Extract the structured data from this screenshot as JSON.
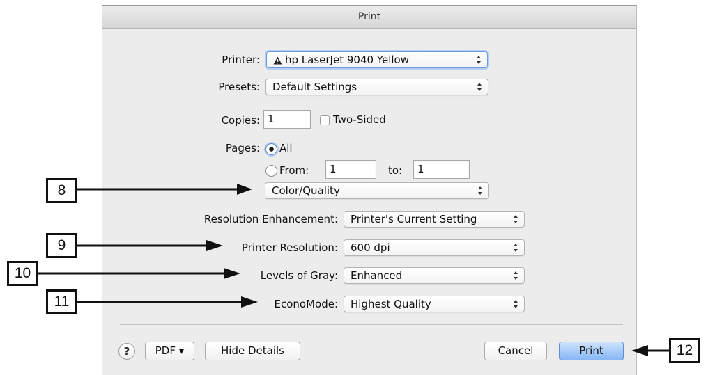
{
  "window": {
    "title": "Print"
  },
  "printer": {
    "label": "Printer:",
    "value": "hp LaserJet 9040 Yellow",
    "icon": "warning-icon"
  },
  "presets": {
    "label": "Presets:",
    "value": "Default Settings"
  },
  "copies": {
    "label": "Copies:",
    "value": "1",
    "two_sided_label": "Two-Sided",
    "two_sided_checked": false
  },
  "pages": {
    "label": "Pages:",
    "all_label": "All",
    "from_label": "From:",
    "from_value": "1",
    "to_label": "to:",
    "to_value": "1",
    "selected": "All"
  },
  "section": {
    "value": "Color/Quality"
  },
  "options": [
    {
      "label": "Resolution Enhancement:",
      "value": "Printer's Current Setting"
    },
    {
      "label": "Printer Resolution:",
      "value": "600 dpi"
    },
    {
      "label": "Levels of Gray:",
      "value": "Enhanced"
    },
    {
      "label": "EconoMode:",
      "value": "Highest Quality"
    }
  ],
  "footer": {
    "help_label": "?",
    "pdf_label": "PDF ▾",
    "hide_details_label": "Hide Details",
    "cancel_label": "Cancel",
    "print_label": "Print"
  },
  "callouts": [
    "8",
    "9",
    "10",
    "11",
    "12"
  ]
}
